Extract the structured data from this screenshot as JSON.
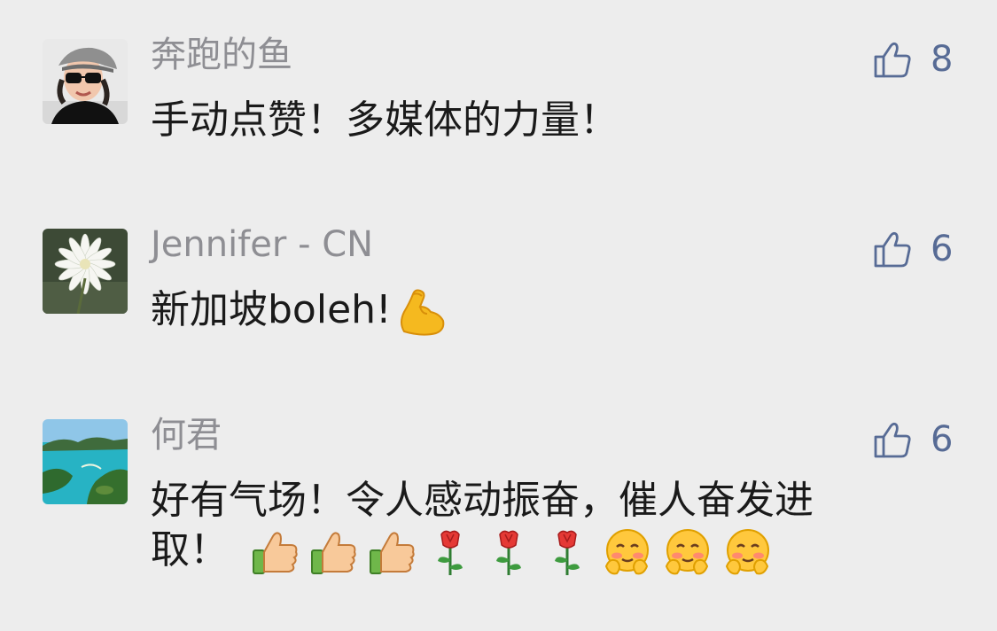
{
  "comments": [
    {
      "user": "奔跑的鱼",
      "likes": "8",
      "text_lines": [
        "手动点赞！多媒体的力量！"
      ],
      "avatar": "woman-sunglasses-avatar"
    },
    {
      "user": "Jennifer - CN",
      "likes": "6",
      "text_lines": [
        "新加坡boleh!"
      ],
      "emojis": [
        "flexed-biceps-emoji"
      ],
      "avatar": "white-flower-avatar"
    },
    {
      "user": "何君",
      "likes": "6",
      "text_lines": [
        "好有气场！令人感动振奋，催人奋发进",
        "取！"
      ],
      "emojis": [
        "thumbs-up-emoji",
        "thumbs-up-emoji",
        "thumbs-up-emoji",
        "rose-emoji",
        "rose-emoji",
        "rose-emoji",
        "blushing-face-emoji",
        "blushing-face-emoji",
        "blushing-face-emoji"
      ],
      "avatar": "island-beach-avatar"
    }
  ],
  "colors": {
    "background": "#ededed",
    "username": "#8e8e93",
    "like_accent": "#576b95",
    "text": "#1a1a1a"
  }
}
